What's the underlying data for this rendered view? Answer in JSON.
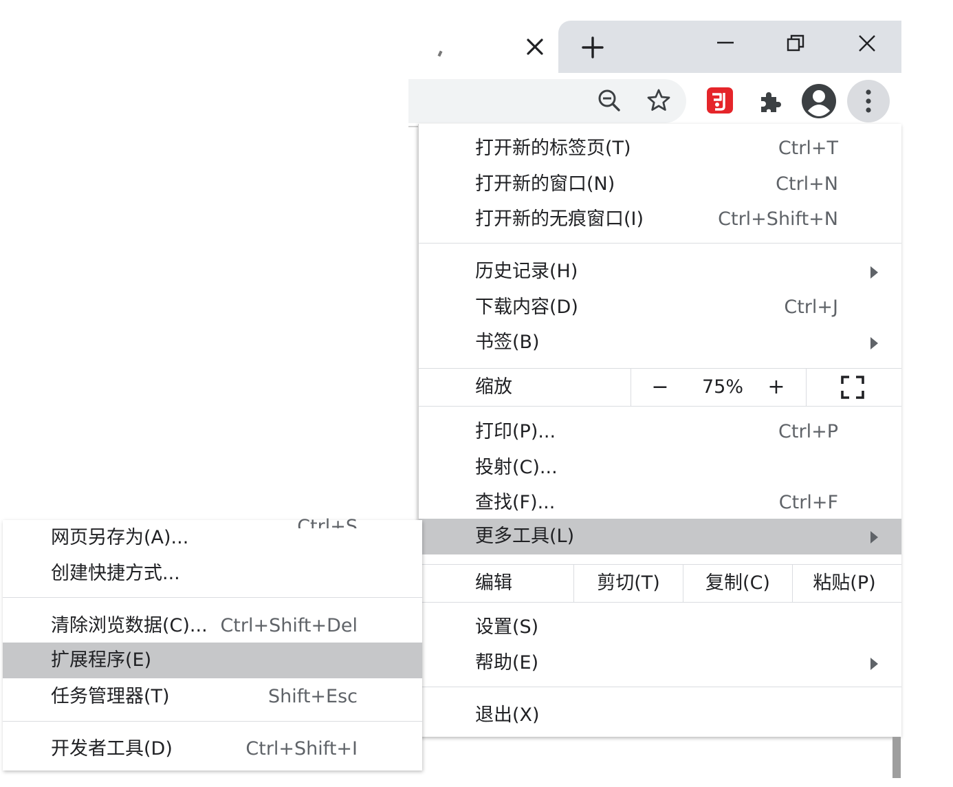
{
  "icons": {
    "tab_close": "close-icon",
    "new_tab": "plus-icon",
    "minimize": "minimize-icon",
    "restore": "restore-icon",
    "window_close": "close-icon",
    "zoom": "zoom-out-icon",
    "bookmark": "star-icon",
    "extension_red": "red-extension-icon",
    "extensions": "puzzle-icon",
    "profile": "avatar-icon",
    "menu": "kebab-menu-icon"
  },
  "colors": {
    "tab_strip": "#dee1e6",
    "highlight": "#c6c7c9",
    "extension_red": "#e5252a",
    "menu_button_bg": "#dadce0"
  },
  "menu": {
    "new_tab": {
      "label": "打开新的标签页(T)",
      "shortcut": "Ctrl+T"
    },
    "new_window": {
      "label": "打开新的窗口(N)",
      "shortcut": "Ctrl+N"
    },
    "new_incognito": {
      "label": "打开新的无痕窗口(I)",
      "shortcut": "Ctrl+Shift+N"
    },
    "history": {
      "label": "历史记录(H)"
    },
    "downloads": {
      "label": "下载内容(D)",
      "shortcut": "Ctrl+J"
    },
    "bookmarks": {
      "label": "书签(B)"
    },
    "zoom": {
      "label": "缩放",
      "minus": "−",
      "value": "75%",
      "plus": "+"
    },
    "print": {
      "label": "打印(P)...",
      "shortcut": "Ctrl+P"
    },
    "cast": {
      "label": "投射(C)..."
    },
    "find": {
      "label": "查找(F)...",
      "shortcut": "Ctrl+F"
    },
    "more_tools": {
      "label": "更多工具(L)"
    },
    "edit": {
      "label": "编辑",
      "cut": "剪切(T)",
      "copy": "复制(C)",
      "paste": "粘贴(P)"
    },
    "settings": {
      "label": "设置(S)"
    },
    "help": {
      "label": "帮助(E)"
    },
    "exit": {
      "label": "退出(X)"
    }
  },
  "submenu": {
    "save_page": {
      "label": "网页另存为(A)...",
      "shortcut": "Ctrl+S"
    },
    "create_shortcut": {
      "label": "创建快捷方式..."
    },
    "clear_data": {
      "label": "清除浏览数据(C)...",
      "shortcut": "Ctrl+Shift+Del"
    },
    "extensions": {
      "label": "扩展程序(E)"
    },
    "task_manager": {
      "label": "任务管理器(T)",
      "shortcut": "Shift+Esc"
    },
    "devtools": {
      "label": "开发者工具(D)",
      "shortcut": "Ctrl+Shift+I"
    }
  }
}
